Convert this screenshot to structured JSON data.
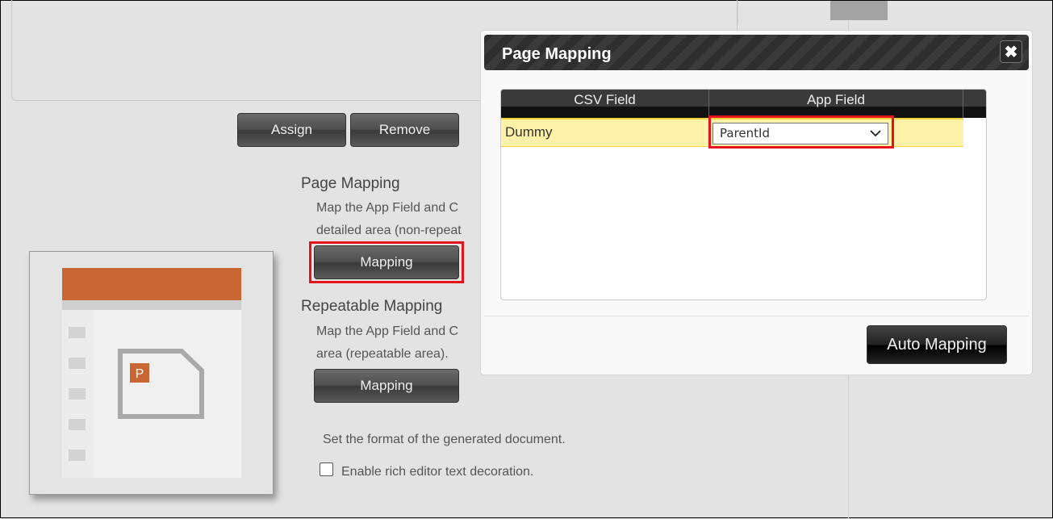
{
  "buttons": {
    "assign": "Assign",
    "remove": "Remove",
    "mapping": "Mapping",
    "mapping2": "Mapping"
  },
  "page_mapping": {
    "title": "Page Mapping",
    "desc1": "Map the App Field and C",
    "desc2": "detailed area (non-repeat"
  },
  "repeatable_mapping": {
    "title": "Repeatable Mapping",
    "desc1": "Map the App Field and C",
    "desc2": "area (repeatable area)."
  },
  "format_text": "Set the format of the generated document.",
  "rich_editor": {
    "label": "Enable rich editor text decoration.",
    "checked": false
  },
  "thumbnail": {
    "badge": "P",
    "accent": "#c96633"
  },
  "modal": {
    "title": "Page Mapping",
    "close_icon": "close-icon",
    "columns": [
      "CSV Field",
      "App Field"
    ],
    "rows": [
      {
        "csv": "Dummy",
        "app": "ParentId"
      }
    ],
    "auto_mapping": "Auto Mapping"
  },
  "highlight_color": "#e3141b"
}
